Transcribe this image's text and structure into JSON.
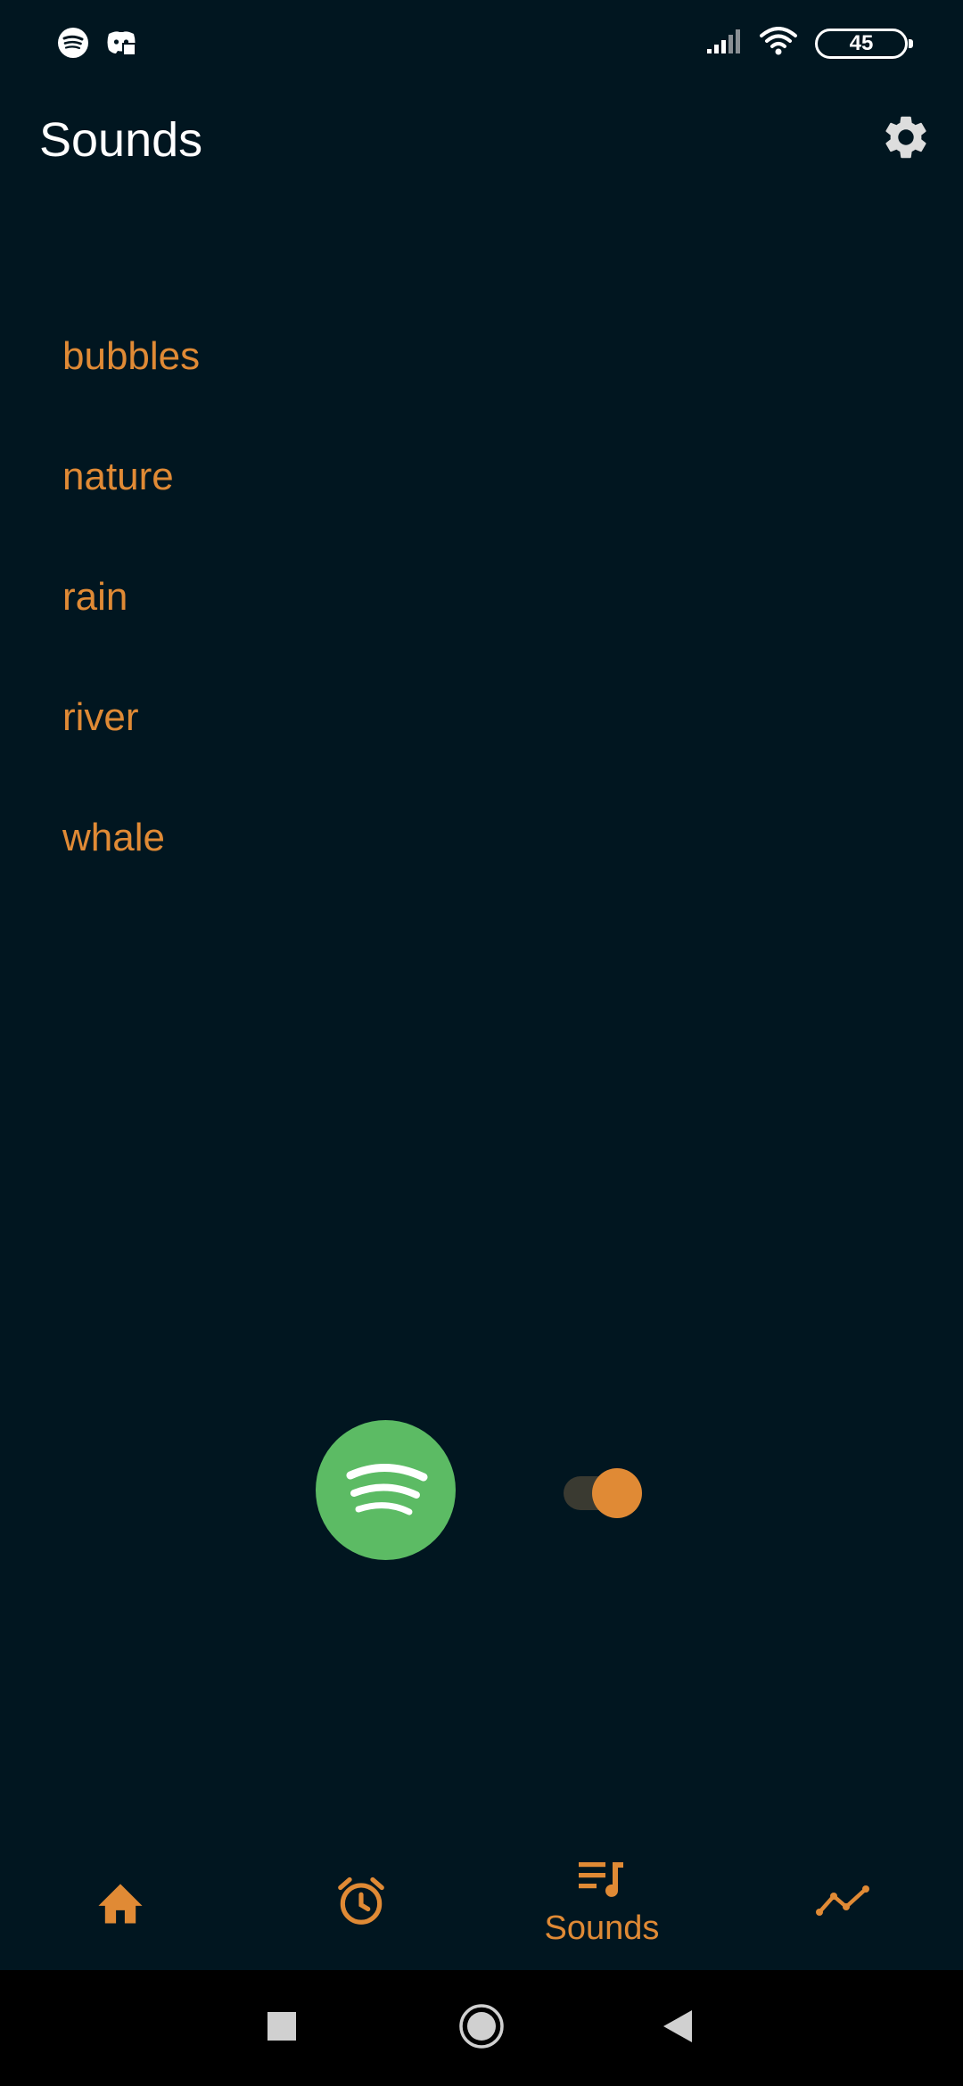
{
  "status_bar": {
    "battery_level": "45",
    "icons": [
      "spotify-icon",
      "discord-icon",
      "signal-icon",
      "wifi-icon",
      "battery-icon"
    ]
  },
  "header": {
    "title": "Sounds",
    "settings_icon": "gear-icon"
  },
  "sounds": {
    "items": [
      {
        "label": "bubbles"
      },
      {
        "label": "nature"
      },
      {
        "label": "rain"
      },
      {
        "label": "river"
      },
      {
        "label": "whale"
      }
    ]
  },
  "controls": {
    "spotify_icon": "spotify-icon",
    "toggle_on": true
  },
  "bottom_nav": {
    "items": [
      {
        "icon": "home-icon",
        "label": "",
        "active": false
      },
      {
        "icon": "alarm-clock-icon",
        "label": "",
        "active": false
      },
      {
        "icon": "queue-music-icon",
        "label": "Sounds",
        "active": true
      },
      {
        "icon": "trend-line-icon",
        "label": "",
        "active": false
      }
    ]
  },
  "system_nav": {
    "icons": [
      "recents-square-icon",
      "home-circle-icon",
      "back-triangle-icon"
    ]
  },
  "colors": {
    "background": "#011620",
    "accent": "#e08a35",
    "spotify_green": "#5cbb64",
    "text_primary": "#ffffff"
  }
}
